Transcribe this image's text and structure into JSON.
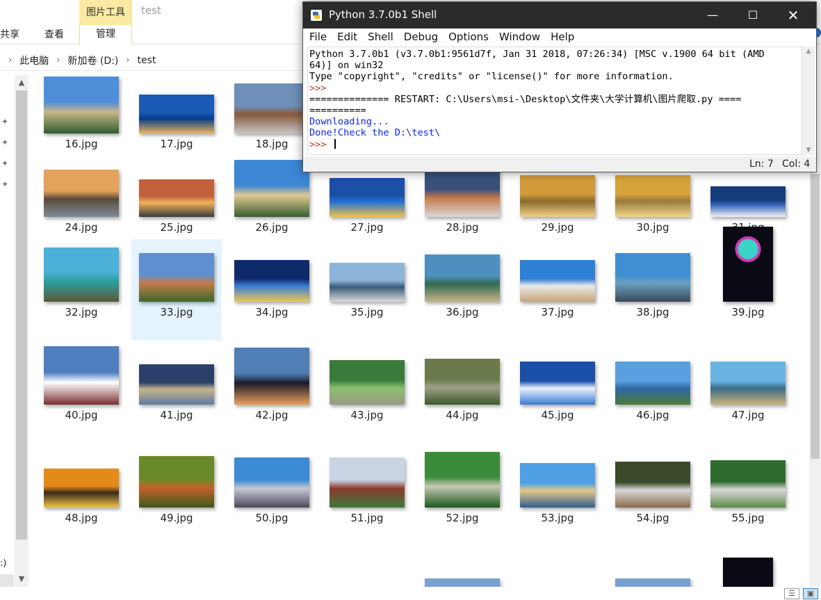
{
  "explorer": {
    "ribbon": {
      "context_tab": "图片工具",
      "tabs": [
        "共享",
        "查看",
        "管理"
      ],
      "folder_title": "test"
    },
    "address": {
      "parts": [
        "此电脑",
        "新加卷 (D:)",
        "test"
      ]
    },
    "nav_text": ":)",
    "files": [
      "16.jpg",
      "17.jpg",
      "18.jpg",
      "24.jpg",
      "25.jpg",
      "26.jpg",
      "27.jpg",
      "28.jpg",
      "29.jpg",
      "30.jpg",
      "31.jpg",
      "32.jpg",
      "33.jpg",
      "34.jpg",
      "35.jpg",
      "36.jpg",
      "37.jpg",
      "38.jpg",
      "39.jpg",
      "40.jpg",
      "41.jpg",
      "42.jpg",
      "43.jpg",
      "44.jpg",
      "45.jpg",
      "46.jpg",
      "47.jpg",
      "48.jpg",
      "49.jpg",
      "50.jpg",
      "51.jpg",
      "52.jpg",
      "53.jpg",
      "54.jpg",
      "55.jpg"
    ],
    "selected_file": "33.jpg"
  },
  "shell": {
    "title": "Python 3.7.0b1 Shell",
    "menu": [
      "File",
      "Edit",
      "Shell",
      "Debug",
      "Options",
      "Window",
      "Help"
    ],
    "lines": {
      "l1": "Python 3.7.0b1 (v3.7.0b1:9561d7f, Jan 31 2018, 07:26:34) [MSC v.1900 64 bit (AMD",
      "l2": "64)] on win32",
      "l3": "Type \"copyright\", \"credits\" or \"license()\" for more information.",
      "l4": ">>> ",
      "l5": "============== RESTART: C:\\Users\\msi-\\Desktop\\文件夹\\大学计算机\\图片爬取.py ====",
      "l6": "==========",
      "l7": "Downloading...",
      "l8": "Done!Check the D:\\test\\",
      "l9": ">>> "
    },
    "status": {
      "ln": "Ln: 7",
      "col": "Col: 4"
    }
  }
}
